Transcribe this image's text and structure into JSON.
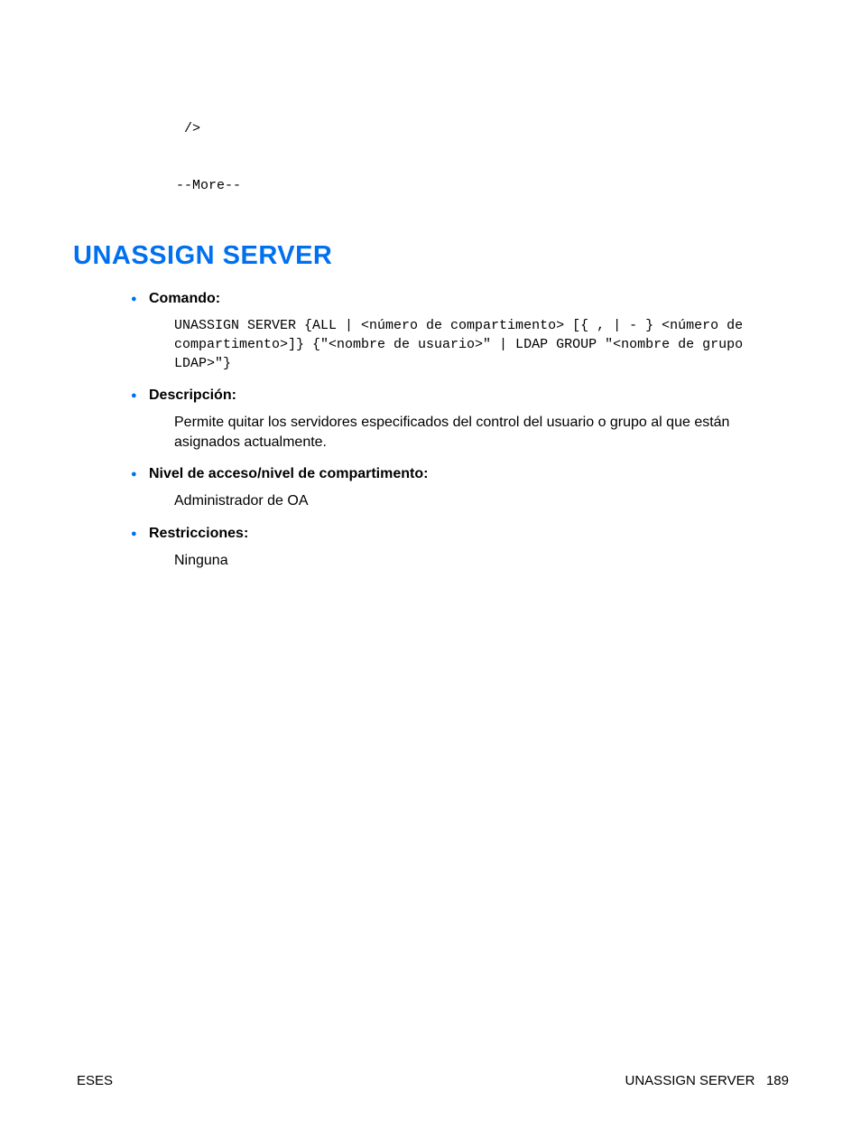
{
  "preamble": {
    "line1": " />",
    "line2": "--More--"
  },
  "heading": "UNASSIGN SERVER",
  "sections": [
    {
      "label": "Comando:",
      "code": "UNASSIGN SERVER {ALL | <número de compartimento> [{ , | - } <número de compartimento>]} {\"<nombre de usuario>\" | LDAP GROUP \"<nombre de grupo LDAP>\"}"
    },
    {
      "label": "Descripción:",
      "text": "Permite quitar los servidores especificados del control del usuario o grupo al que están asignados actualmente."
    },
    {
      "label": "Nivel de acceso/nivel de compartimento:",
      "text": "Administrador de OA"
    },
    {
      "label": "Restricciones:",
      "text": "Ninguna"
    }
  ],
  "footer": {
    "left": "ESES",
    "right_label": "UNASSIGN SERVER",
    "page_no": "189"
  }
}
